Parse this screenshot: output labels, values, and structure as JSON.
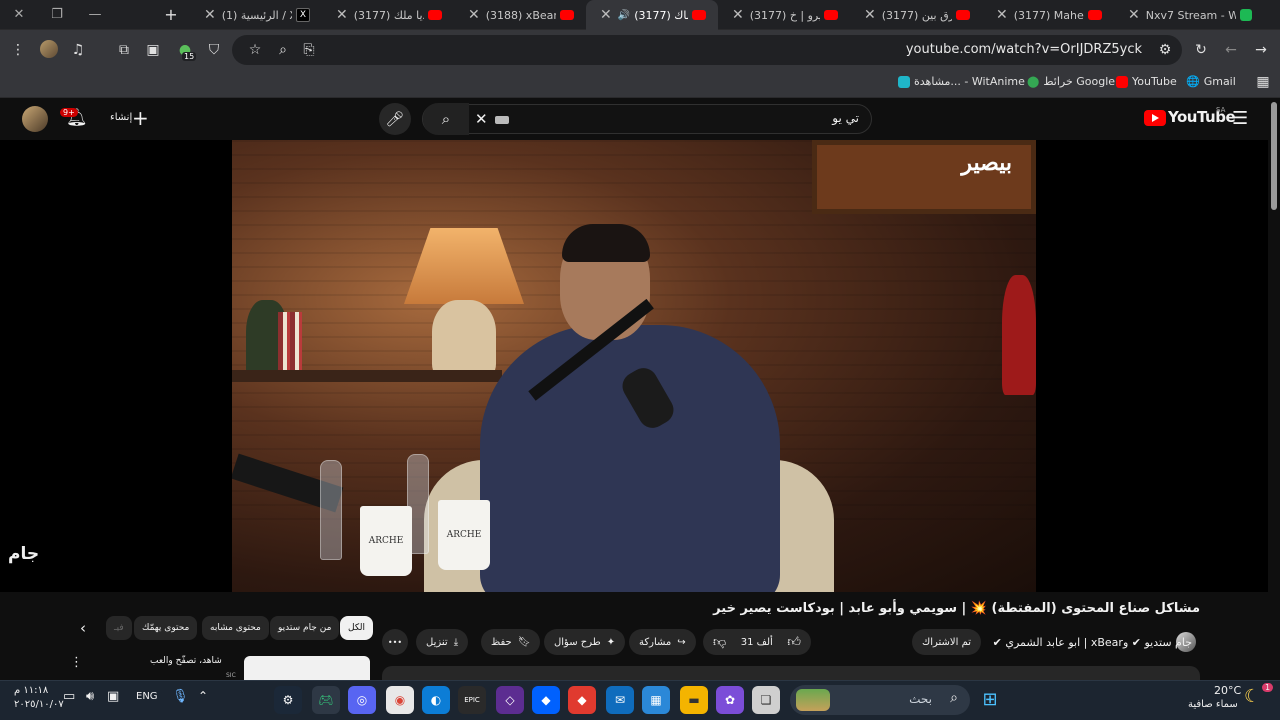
{
  "browser": {
    "tabs": [
      {
        "label": "Nxv7 Stream - W",
        "favicon": "green-k-icon"
      },
      {
        "label": "(3177) Maher Za",
        "favicon": "youtube-icon"
      },
      {
        "label": "(3177) الفرق بين",
        "favicon": "youtube-icon"
      },
      {
        "label": "(3177) سكيرو | خ",
        "favicon": "youtube-icon"
      },
      {
        "label": "(3177) مشاك",
        "favicon": "youtube-icon",
        "active": true
      },
      {
        "label": "(3188) xBear | ري",
        "favicon": "youtube-icon"
      },
      {
        "label": "(3177) ناديا ملك",
        "favicon": "youtube-icon"
      },
      {
        "label": "(1) الرئيسية / X",
        "favicon": "x-icon"
      }
    ],
    "new_tab": "+",
    "url": "youtube.com/watch?v=OrIJDRZ5yck",
    "extension_badge": "15",
    "bookmarks": [
      {
        "label": "Gmail"
      },
      {
        "label": "YouTube"
      },
      {
        "label": "خرائط Google"
      },
      {
        "label": "مشاهدة... - WitAnime"
      }
    ]
  },
  "youtube": {
    "logo_text": "YouTube",
    "logo_region": "SA",
    "search_query": "تي يو",
    "create_label": "إنشاء",
    "notification_count": "9+",
    "video": {
      "brand_mark": "بيصير",
      "watermark": "جام",
      "cup_label": "ARCHE",
      "title": "مشاكل صناع المحتوى (المفتطة) 💥 | سويمي وأبو عابد | بودكاست يصير خير",
      "channel_line": "جام ستديو ✔ وxBear | ابو عابد الشمري ✔",
      "subscribed_label": "تم الاشتراك",
      "likes": "31 ألف",
      "share_label": "مشاركة",
      "ask_label": "طرح سؤال",
      "save_label": "حفظ",
      "download_label": "تنزيل",
      "more_label": "•••"
    },
    "chips": [
      {
        "label": "الكل",
        "selected": true
      },
      {
        "label": "من جام ستديو"
      },
      {
        "label": "محتوى مشابه"
      },
      {
        "label": "محتوى يهمّك"
      },
      {
        "label": "فيـ"
      }
    ],
    "sidebar_snippet": "شاهد، تصفّح والعب",
    "sidebar_meta": "SIC"
  },
  "taskbar": {
    "search_placeholder": "بحث",
    "weather_temp": "20°C",
    "weather_desc": "سماء صافية",
    "language": "ENG",
    "time": "١١:١٨ م",
    "date": "٢٠٢٥/١٠/٠٧",
    "weather_badge": "1"
  }
}
